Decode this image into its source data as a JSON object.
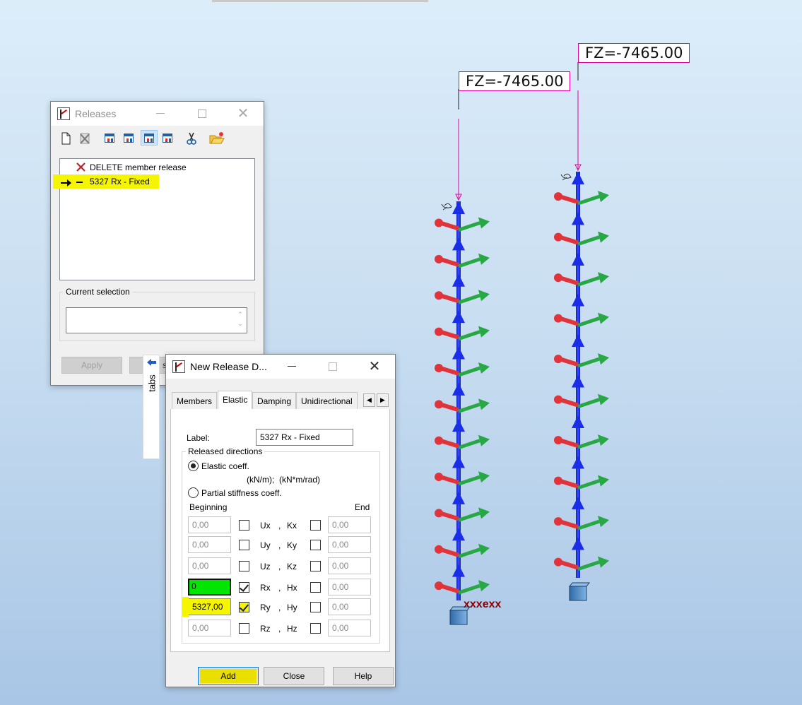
{
  "model_view": {
    "annotations": [
      {
        "text": "FZ=-7465.00"
      },
      {
        "text": "FZ=-7465.00"
      }
    ],
    "node_tag": "xxxexx",
    "colors": {
      "member": "#1a2ee8",
      "arrow_red": "#e0343a",
      "arrow_green": "#28a745",
      "load_line": "#e000a0",
      "annotation_border": "#e000a0",
      "support": "#4d86c2"
    }
  },
  "releases": {
    "title": "Releases",
    "toolbar": [
      "new-icon",
      "delete-icon",
      "member-view-icon",
      "node-view-icon",
      "grid-view-icon",
      "table-view-icon",
      "cut-icon",
      "folder-open-icon"
    ],
    "list": [
      {
        "icon": "delete-x-icon",
        "label": "DELETE member release"
      },
      {
        "icon": "arrow-icon",
        "label": "5327 Rx - Fixed"
      }
    ],
    "current_selection_label": "Current selection",
    "current_selection_value": "",
    "apply_label": "Apply",
    "hidden_button_label": "s"
  },
  "tabs_strip": {
    "label": "tabs"
  },
  "new_release": {
    "title": "New Release D...",
    "tabs": [
      "Members",
      "Elastic",
      "Damping",
      "Unidirectional"
    ],
    "active_tab": "Elastic",
    "label_caption": "Label:",
    "label_value": "5327 Rx - Fixed",
    "released_directions": "Released directions",
    "elastic_coeff": "Elastic coeff.",
    "units": "(kN/m);  (kN*m/rad)",
    "partial_stiffness": "Partial stiffness coeff.",
    "beginning": "Beginning",
    "end": "End",
    "rows": [
      {
        "u": "Ux",
        "k": "Kx",
        "begin": "0,00",
        "begin_checked": false,
        "end": "0,00",
        "end_checked": false
      },
      {
        "u": "Uy",
        "k": "Ky",
        "begin": "0,00",
        "begin_checked": false,
        "end": "0,00",
        "end_checked": false
      },
      {
        "u": "Uz",
        "k": "Kz",
        "begin": "0,00",
        "begin_checked": false,
        "end": "0,00",
        "end_checked": false
      },
      {
        "u": "Rx",
        "k": "Hx",
        "begin": "0",
        "begin_checked": true,
        "end": "0,00",
        "end_checked": false
      },
      {
        "u": "Ry",
        "k": "Hy",
        "begin": "5327,00",
        "begin_checked": true,
        "end": "0,00",
        "end_checked": false
      },
      {
        "u": "Rz",
        "k": "Hz",
        "begin": "0,00",
        "begin_checked": false,
        "end": "0,00",
        "end_checked": false
      }
    ],
    "comma": ",",
    "add_label": "Add",
    "close_label": "Close",
    "help_label": "Help"
  }
}
